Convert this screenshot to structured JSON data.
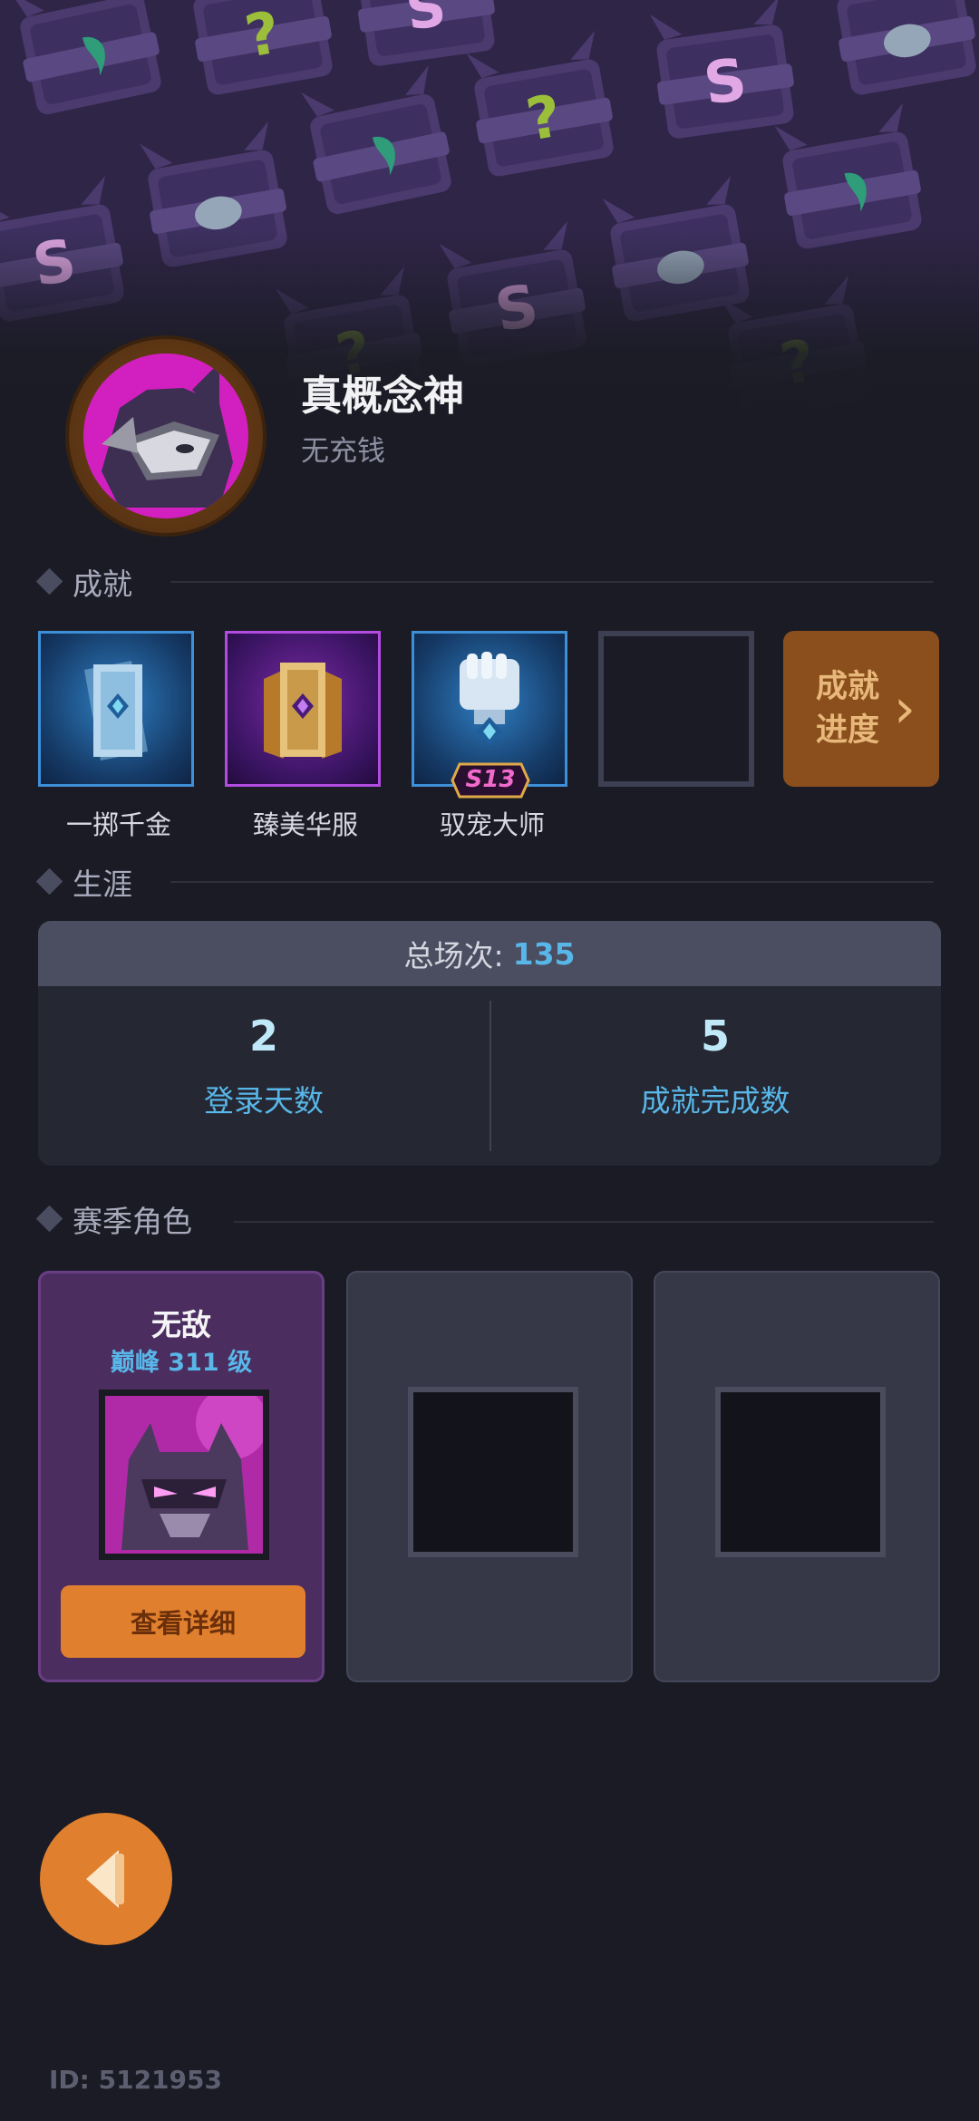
{
  "profile": {
    "nickname": "真概念神",
    "subtitle": "无充钱"
  },
  "sections": {
    "achievements": "成就",
    "career": "生涯",
    "season_roles": "赛季角色"
  },
  "achievements": [
    {
      "name": "一掷千金",
      "icon": "card-stack-blue-icon"
    },
    {
      "name": "臻美华服",
      "icon": "card-stack-gold-icon"
    },
    {
      "name": "驭宠大师",
      "icon": "fist-icon",
      "badge": "S13"
    },
    {
      "name": "",
      "icon": "empty-slot"
    }
  ],
  "achievement_progress": {
    "label": "成就进度",
    "arrow": "›"
  },
  "career": {
    "total_label": "总场次:",
    "total_value": "135",
    "stats": [
      {
        "value": "2",
        "label": "登录天数"
      },
      {
        "value": "5",
        "label": "成就完成数"
      }
    ]
  },
  "season_roles": {
    "role": {
      "name": "无敌",
      "level": "巅峰 311 级",
      "detail_label": "查看详细"
    },
    "empty_slots": 2
  },
  "footer": {
    "id_text": "ID: 5121953"
  },
  "colors": {
    "accent_orange": "#e07f2e",
    "accent_blue": "#58b7e8",
    "background": "#1a1b24"
  }
}
